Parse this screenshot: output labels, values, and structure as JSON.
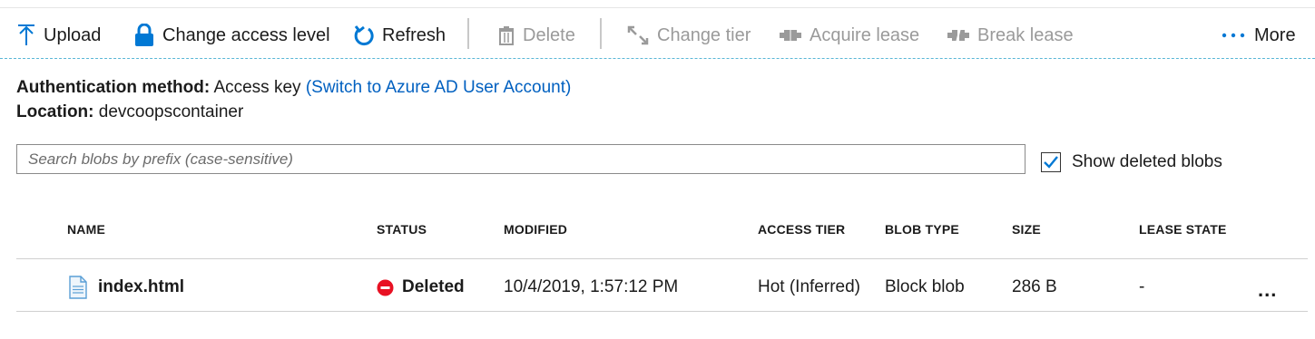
{
  "toolbar": {
    "upload": "Upload",
    "change_access": "Change access level",
    "refresh": "Refresh",
    "delete": "Delete",
    "change_tier": "Change tier",
    "acquire_lease": "Acquire lease",
    "break_lease": "Break lease",
    "more": "More"
  },
  "info": {
    "auth_label": "Authentication method:",
    "auth_value": "Access key",
    "auth_link": "(Switch to Azure AD User Account)",
    "location_label": "Location:",
    "location_value": "devcoopscontainer"
  },
  "search": {
    "placeholder": "Search blobs by prefix (case-sensitive)",
    "value": ""
  },
  "show_deleted": {
    "label": "Show deleted blobs",
    "checked": true
  },
  "table": {
    "headers": [
      "NAME",
      "STATUS",
      "MODIFIED",
      "ACCESS TIER",
      "BLOB TYPE",
      "SIZE",
      "LEASE STATE"
    ],
    "rows": [
      {
        "name": "index.html",
        "status": "Deleted",
        "modified": "10/4/2019, 1:57:12 PM",
        "access_tier": "Hot (Inferred)",
        "blob_type": "Block blob",
        "size": "286 B",
        "lease_state": "-",
        "actions": "..."
      }
    ]
  },
  "colors": {
    "accent": "#0078d4",
    "link": "#0060c0",
    "disabled": "#9a9a9a",
    "deleted": "#e81123",
    "divider": "#59b6d6"
  },
  "icons": {
    "upload": "upload-arrow-icon",
    "change_access": "lock-icon",
    "refresh": "refresh-icon",
    "delete": "trash-icon",
    "change_tier": "change-tier-icon",
    "acquire_lease": "acquire-lease-icon",
    "break_lease": "break-lease-icon",
    "more": "ellipsis-icon",
    "file": "document-icon",
    "status_deleted": "deleted-status-icon"
  }
}
